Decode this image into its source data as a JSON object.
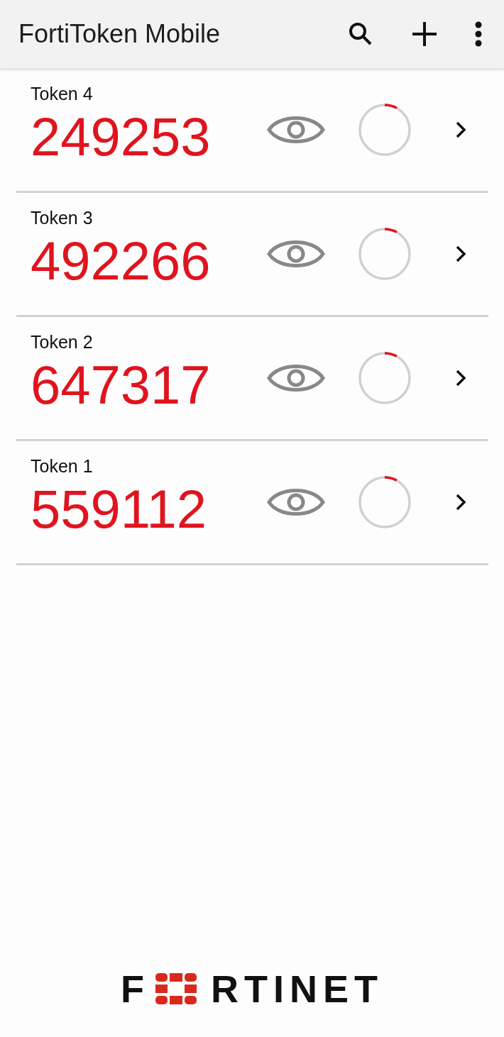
{
  "app_bar": {
    "title": "FortiToken Mobile"
  },
  "tokens": [
    {
      "name": "Token 4",
      "code": "249253",
      "level": 0.08
    },
    {
      "name": "Token 3",
      "code": "492266",
      "level": 0.08
    },
    {
      "name": "Token 2",
      "code": "647317",
      "level": 0.08
    },
    {
      "name": "Token 1",
      "code": "559112",
      "level": 0.08
    }
  ],
  "logo": {
    "lead": "F",
    "tail": "RTINET"
  }
}
